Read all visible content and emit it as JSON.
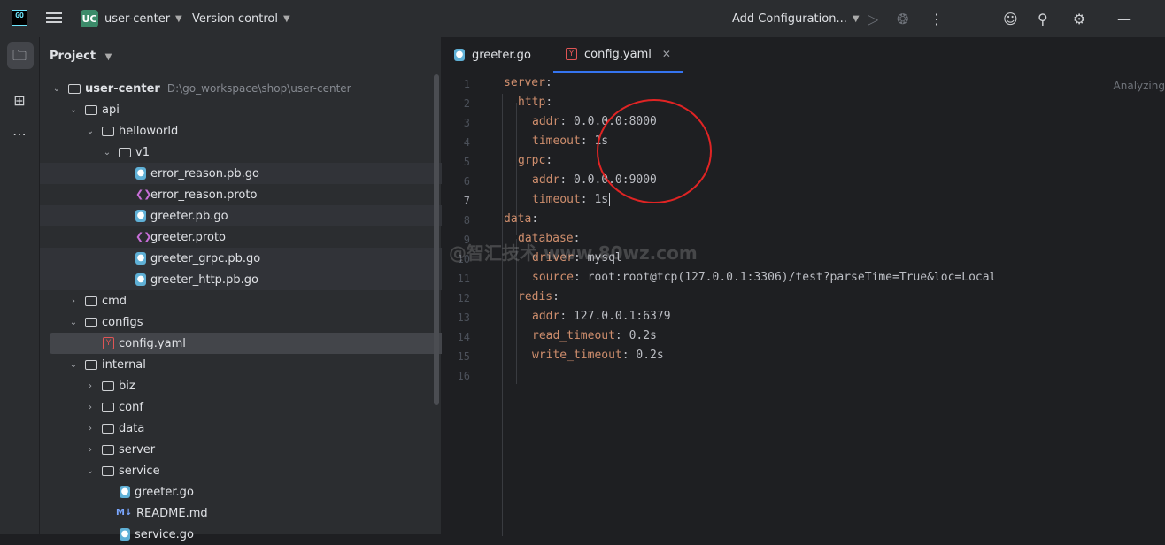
{
  "topbar": {
    "logo_text": "GO",
    "project_badge": "UC",
    "project_name": "user-center",
    "vcs": "Version control",
    "run_config": "Add Configuration..."
  },
  "project_panel": {
    "title": "Project"
  },
  "tree": [
    {
      "label": "user-center",
      "path": "D:\\go_workspace\\shop\\user-center"
    },
    {
      "label": "api"
    },
    {
      "label": "helloworld"
    },
    {
      "label": "v1"
    },
    {
      "label": "error_reason.pb.go"
    },
    {
      "label": "error_reason.proto"
    },
    {
      "label": "greeter.pb.go"
    },
    {
      "label": "greeter.proto"
    },
    {
      "label": "greeter_grpc.pb.go"
    },
    {
      "label": "greeter_http.pb.go"
    },
    {
      "label": "cmd"
    },
    {
      "label": "configs"
    },
    {
      "label": "config.yaml"
    },
    {
      "label": "internal"
    },
    {
      "label": "biz"
    },
    {
      "label": "conf"
    },
    {
      "label": "data"
    },
    {
      "label": "server"
    },
    {
      "label": "service"
    },
    {
      "label": "greeter.go"
    },
    {
      "label": "README.md"
    },
    {
      "label": "service.go"
    }
  ],
  "editor": {
    "tabs": [
      {
        "label": "greeter.go"
      },
      {
        "label": "config.yaml"
      }
    ],
    "status": "Analyzing",
    "watermark": "@智汇技术 www.80wz.com",
    "lines": [
      {
        "n": "1",
        "key": "server",
        "rest": ":"
      },
      {
        "n": "2",
        "key": "http",
        "rest": ":"
      },
      {
        "n": "3",
        "key": "addr",
        "rest": ": 0.0.0.0:8000"
      },
      {
        "n": "4",
        "key": "timeout",
        "rest": ": 1s"
      },
      {
        "n": "5",
        "key": "grpc",
        "rest": ":"
      },
      {
        "n": "6",
        "key": "addr",
        "rest": ": 0.0.0.0:9000"
      },
      {
        "n": "7",
        "key": "timeout",
        "rest": ": 1s"
      },
      {
        "n": "8",
        "key": "data",
        "rest": ":"
      },
      {
        "n": "9",
        "key": "database",
        "rest": ":"
      },
      {
        "n": "10",
        "key": "driver",
        "rest": ": mysql"
      },
      {
        "n": "11",
        "key": "source",
        "rest": ": root:root@tcp(127.0.0.1:3306)/test?parseTime=True&loc=Local"
      },
      {
        "n": "12",
        "key": "redis",
        "rest": ":"
      },
      {
        "n": "13",
        "key": "addr",
        "rest": ": 127.0.0.1:6379"
      },
      {
        "n": "14",
        "key": "read_timeout",
        "rest": ": 0.2s"
      },
      {
        "n": "15",
        "key": "write_timeout",
        "rest": ": 0.2s"
      },
      {
        "n": "16",
        "key": "",
        "rest": ""
      }
    ]
  }
}
